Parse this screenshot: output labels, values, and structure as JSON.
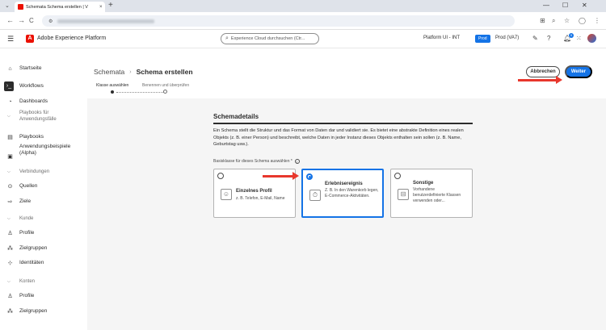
{
  "browser": {
    "tab_title": "Schemata Schema erstellen | V",
    "tab_close": "×",
    "new_tab": "+",
    "back": "←",
    "forward": "→",
    "reload": "C",
    "minimize": "—",
    "maximize": "☐",
    "close": "✕"
  },
  "header": {
    "app_name": "Adobe Experience Platform",
    "search_placeholder": "Experience Cloud durchsuchen (Ctr...",
    "org": "Platform UI - INT",
    "sandbox_badge": "Prod",
    "sandbox": "Prod (VA7)",
    "notification_count": "9"
  },
  "sidebar": {
    "items": [
      {
        "label": "Startseite",
        "icon": "home-icon"
      },
      {
        "label": "Workflows",
        "icon": "workflows-icon"
      },
      {
        "label": "Dashboards",
        "icon": "dashboards-icon"
      },
      {
        "label": "Playbooks für Anwendungsfälle",
        "section": true
      },
      {
        "label": "Playbooks",
        "icon": "playbooks-icon"
      },
      {
        "label": "Anwendungsbeispiele (Alpha)",
        "icon": "examples-icon"
      },
      {
        "label": "Verbindungen",
        "section": true
      },
      {
        "label": "Quellen",
        "icon": "sources-icon"
      },
      {
        "label": "Ziele",
        "icon": "destinations-icon"
      },
      {
        "label": "Kunde",
        "section": true
      },
      {
        "label": "Profile",
        "icon": "profile-icon"
      },
      {
        "label": "Zielgruppen",
        "icon": "audiences-icon"
      },
      {
        "label": "Identitäten",
        "icon": "identities-icon"
      },
      {
        "label": "Konten",
        "section": true
      },
      {
        "label": "Profile",
        "icon": "profile-icon"
      },
      {
        "label": "Zielgruppen",
        "icon": "audiences-icon"
      }
    ]
  },
  "main": {
    "breadcrumb_parent": "Schemata",
    "breadcrumb_sep": "›",
    "breadcrumb_current": "Schema erstellen",
    "cancel_label": "Abbrechen",
    "next_label": "Weiter",
    "steps": [
      "Klasse auswählen",
      "Benennen und überprüfen"
    ],
    "section_title": "Schemadetails",
    "description": "Ein Schema stellt die Struktur und das Format von Daten dar und validiert sie. Es bietet eine abstrakte Definition eines realen Objekts (z. B. einer Person) und beschreibt, welche Daten in jeder Instanz dieses Objekts enthalten sein sollen (z. B. Name, Geburtstag usw.).",
    "base_class_label": "Basisklasse für dieses Schema auswählen *",
    "cards": [
      {
        "title": "Einzelnes Profil",
        "desc": "z. B. Telefon, E-Mail, Name",
        "selected": false
      },
      {
        "title": "Erlebnisereignis",
        "desc": "Z. B. In den Warenkorb legen, E-Commerce-Aktivitäten.",
        "selected": true
      },
      {
        "title": "Sonstige",
        "desc": "Vorhandene benutzerdefinierte Klassen verwenden oder...",
        "selected": false
      }
    ]
  },
  "colors": {
    "accent": "#1473e6",
    "annotation_arrow": "#e8372c",
    "brand": "#eb1000"
  }
}
